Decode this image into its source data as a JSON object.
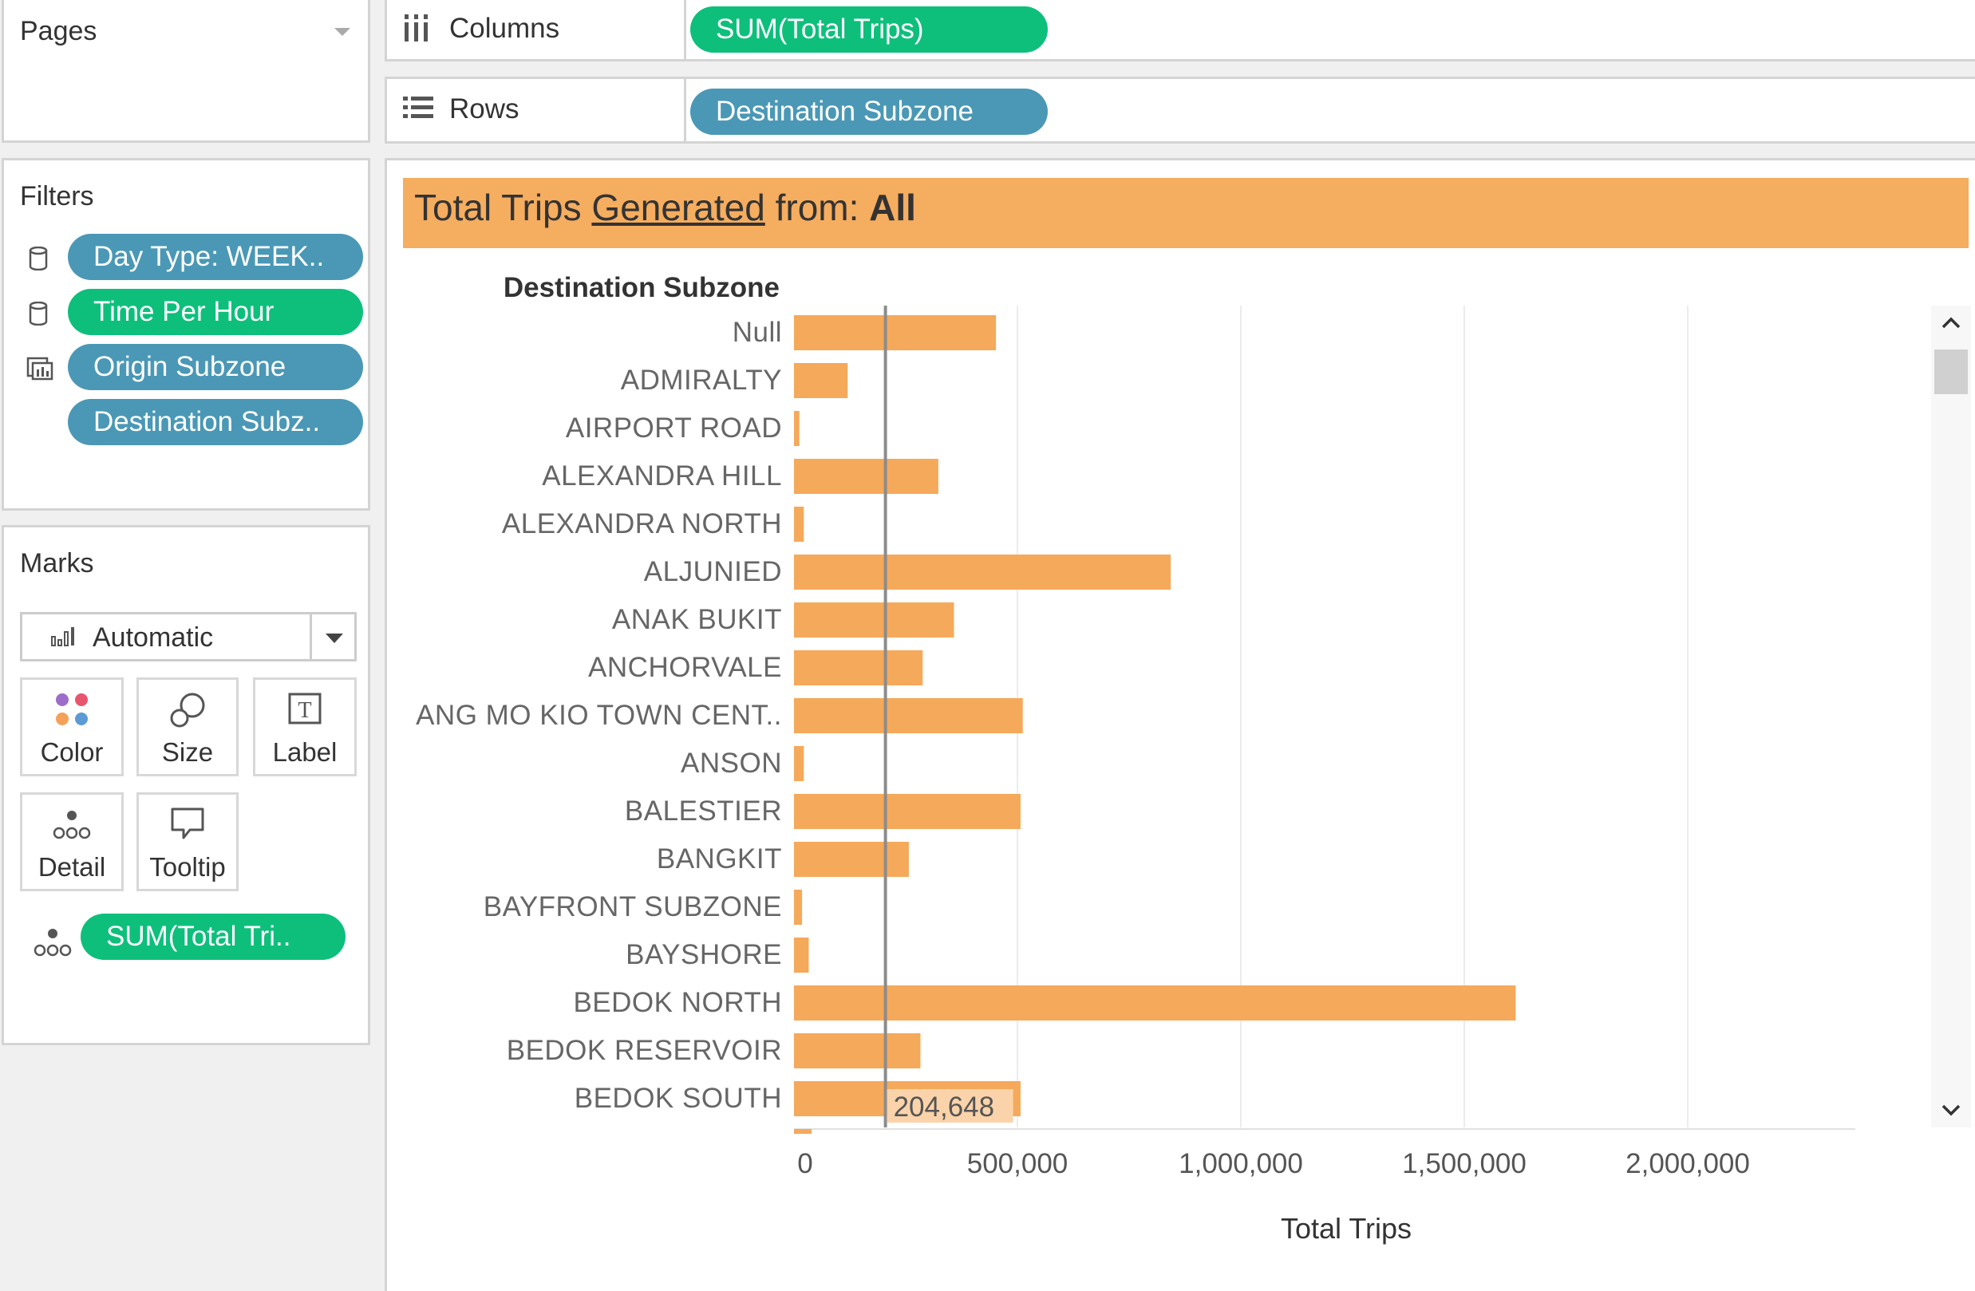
{
  "shelves": {
    "pages": {
      "title": "Pages"
    },
    "columns": {
      "label": "Columns",
      "pill": "SUM(Total Trips)"
    },
    "rows": {
      "label": "Rows",
      "pill": "Destination Subzone"
    }
  },
  "filters": {
    "title": "Filters",
    "items": [
      {
        "label": "Day Type: WEEK..",
        "color": "#4a98b6",
        "icon": "database-icon"
      },
      {
        "label": "Time Per Hour",
        "color": "#0ebf7c",
        "icon": "database-icon"
      },
      {
        "label": "Origin Subzone",
        "color": "#4a98b6",
        "icon": "sheets-icon"
      },
      {
        "label": "Destination Subz..",
        "color": "#4a98b6",
        "icon": "none"
      }
    ]
  },
  "marks": {
    "title": "Marks",
    "type_value": "Automatic",
    "cards": {
      "color": "Color",
      "size": "Size",
      "label": "Label",
      "detail": "Detail",
      "tooltip": "Tooltip"
    },
    "detail_pill": "SUM(Total Tri.."
  },
  "chart": {
    "title_prefix": "Total Trips ",
    "title_link": "Generated",
    "title_mid": " from: ",
    "title_value": "All",
    "title_bg": "#f5ad5f",
    "row_header": "Destination Subzone",
    "xlabel": "Total Trips",
    "reference_label": "204,648",
    "bar_color": "#f5a95a"
  },
  "chart_data": {
    "type": "bar",
    "orientation": "horizontal",
    "title": "Total Trips Generated from: All",
    "xlabel": "Total Trips",
    "ylabel": "Destination Subzone",
    "xlim": [
      0,
      2500000
    ],
    "xticks": [
      "0",
      "500,000",
      "1,000,000",
      "1,500,000",
      "2,000,000"
    ],
    "xtick_values": [
      0,
      500000,
      1000000,
      1500000,
      2000000
    ],
    "reference_line": 204648,
    "reference_line_label": "204,648",
    "categories": [
      "Null",
      "ADMIRALTY",
      "AIRPORT ROAD",
      "ALEXANDRA HILL",
      "ALEXANDRA NORTH",
      "ALJUNIED",
      "ANAK BUKIT",
      "ANCHORVALE",
      "ANG MO KIO TOWN CENT..",
      "ANSON",
      "BALESTIER",
      "BANGKIT",
      "BAYFRONT SUBZONE",
      "BAYSHORE",
      "BEDOK NORTH",
      "BEDOK RESERVOIR",
      "BEDOK SOUTH"
    ],
    "values": [
      452000,
      120000,
      12000,
      323000,
      22000,
      843000,
      358000,
      288000,
      512000,
      22000,
      507000,
      257000,
      18000,
      33000,
      1615000,
      283000,
      507000
    ],
    "grid": true
  }
}
